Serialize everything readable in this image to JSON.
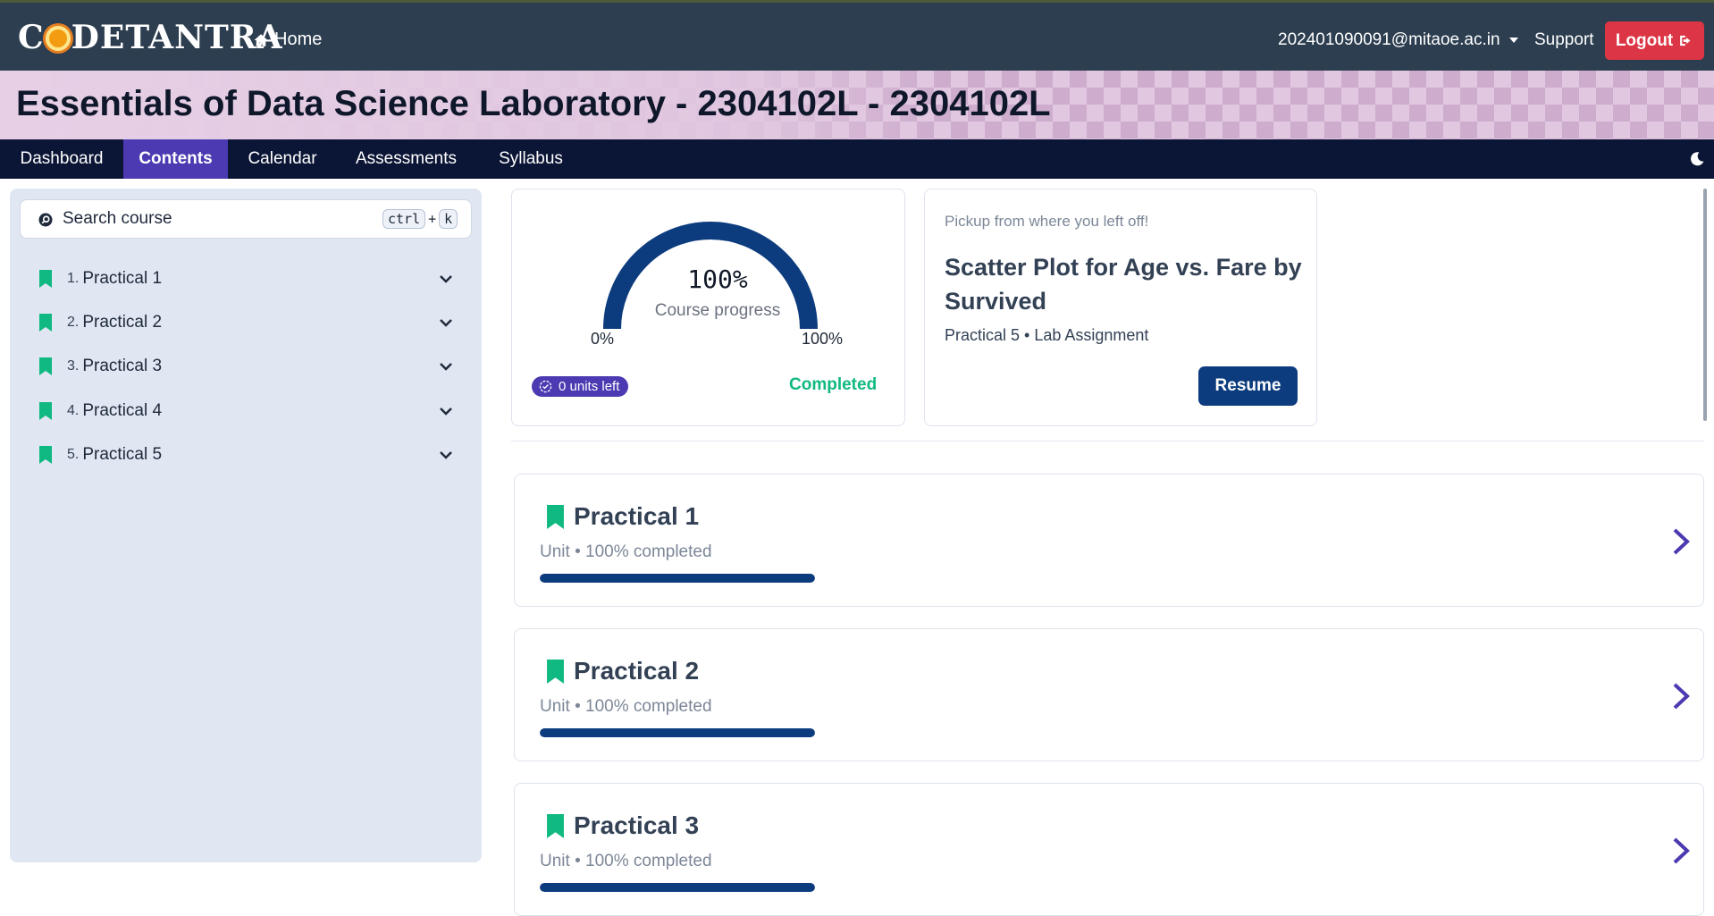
{
  "header": {
    "logo": {
      "pre": "C",
      "post": "DETANTRA"
    },
    "home_label": "Home",
    "user_email": "202401090091@mitaoe.ac.in",
    "support_label": "Support",
    "logout_label": "Logout"
  },
  "course": {
    "title": "Essentials of Data Science Laboratory - 2304102L - 2304102L"
  },
  "nav": {
    "tabs": [
      {
        "label": "Dashboard",
        "active": false
      },
      {
        "label": "Contents",
        "active": true
      },
      {
        "label": "Calendar",
        "active": false
      },
      {
        "label": "Assessments",
        "active": false
      },
      {
        "label": "Syllabus",
        "active": false
      }
    ],
    "theme_icon": "moon-icon"
  },
  "sidebar": {
    "search_placeholder": "Search course",
    "shortcut": {
      "key1": "ctrl",
      "plus": "+",
      "key2": "k"
    },
    "items": [
      {
        "num": "1.",
        "label": "Practical 1"
      },
      {
        "num": "2.",
        "label": "Practical 2"
      },
      {
        "num": "3.",
        "label": "Practical 3"
      },
      {
        "num": "4.",
        "label": "Practical 4"
      },
      {
        "num": "5.",
        "label": "Practical 5"
      }
    ]
  },
  "progress": {
    "percent_text": "100%",
    "percent_value": 100,
    "label": "Course progress",
    "min_label": "0%",
    "max_label": "100%",
    "units_left": "0 units left",
    "status": "Completed"
  },
  "resume": {
    "pickup_text": "Pickup from where you left off!",
    "title": "Scatter Plot for Age vs. Fare by Survived",
    "meta": "Practical 5 • Lab Assignment",
    "button_label": "Resume"
  },
  "units": [
    {
      "title": "Practical 1",
      "meta": "Unit • 100% completed",
      "progress": 1.0
    },
    {
      "title": "Practical 2",
      "meta": "Unit • 100% completed",
      "progress": 1.0
    },
    {
      "title": "Practical 3",
      "meta": "Unit • 100% completed",
      "progress": 1.0
    }
  ],
  "colors": {
    "topbar": "#2c3e50",
    "nav": "#0b1535",
    "accent": "#4b3ab1",
    "bookmark": "#10b981",
    "progress": "#0d3c7e",
    "logout": "#dc3545"
  }
}
